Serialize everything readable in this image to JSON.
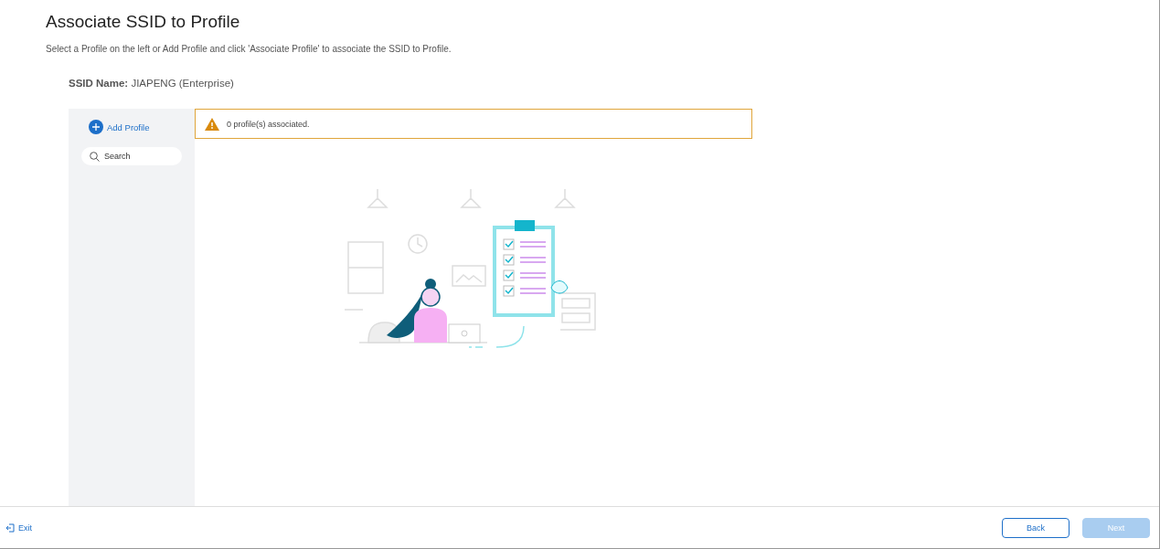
{
  "title": "Associate SSID to Profile",
  "subtitle": "Select a Profile on the left or Add Profile and click 'Associate Profile' to associate the SSID to Profile.",
  "ssid": {
    "label": "SSID Name:",
    "value": "JIAPENG (Enterprise)"
  },
  "sidebar": {
    "add_profile": "Add Profile",
    "search": {
      "placeholder": "Search"
    }
  },
  "alert": {
    "text": "0 profile(s) associated."
  },
  "footer": {
    "exit": "Exit",
    "buttons": [
      {
        "label": "Back",
        "kind": "secondary",
        "disabled": false
      },
      {
        "label": "Next",
        "kind": "primary",
        "disabled": true
      }
    ]
  }
}
